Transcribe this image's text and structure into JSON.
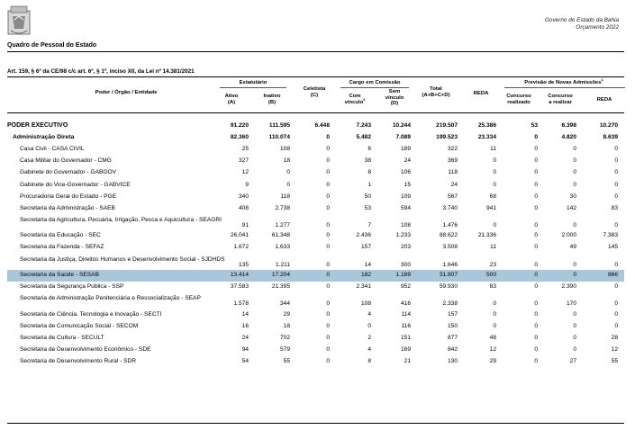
{
  "header": {
    "government": "Governo do Estado da Bahia",
    "budget": "Orçamento 2022"
  },
  "title": "Quadro de Pessoal do Estado",
  "article": "Art. 159, § 6º da CE/98 c/c art. 6º, § 1º, inciso XII, da Lei nº 14.381/2021",
  "headers": {
    "entity": "Poder / Órgão / Entidade",
    "statutory_group": "Estatutário",
    "active": "Ativo",
    "active_code": "(A)",
    "inactive": "Inativo",
    "inactive_code": "(B)",
    "celetista": "Celetista",
    "celetista_code": "(C)",
    "commission_group": "Cargo em Comissão",
    "with_link": "Com",
    "with_link_2": "vínculo",
    "with_link_sup": "2",
    "without_link": "Sem",
    "without_link_2": "vínculo",
    "without_link_code": "(D)",
    "total": "Total",
    "total_code": "(A+B+C+D)",
    "reda": "REDA",
    "admissions_group": "Previsão de Novas Admissões",
    "admissions_sup": "1",
    "contest_done": "Concurso",
    "contest_done_2": "realizado",
    "contest_todo": "Concurso",
    "contest_todo_2": "a realizar",
    "reda_new": "REDA"
  },
  "highlight_color": "#a9c6da",
  "rows": [
    {
      "name": "PODER EXECUTIVO",
      "level": 0,
      "values": [
        "91.220",
        "111.595",
        "6.448",
        "7.243",
        "10.244",
        "219.507",
        "25.386",
        "53",
        "6.398",
        "10.270"
      ]
    },
    {
      "name": "Administração Direta",
      "level": 1,
      "values": [
        "82.360",
        "110.074",
        "0",
        "5.482",
        "7.089",
        "199.523",
        "23.334",
        "0",
        "4.820",
        "8.639"
      ]
    },
    {
      "name": "Casa Civil - CASA CIVIL",
      "level": 2,
      "values": [
        "25",
        "108",
        "0",
        "6",
        "189",
        "322",
        "11",
        "0",
        "0",
        "0"
      ]
    },
    {
      "name": "Casa Militar do Governador - CMG",
      "level": 2,
      "values": [
        "327",
        "18",
        "0",
        "38",
        "24",
        "369",
        "0",
        "0",
        "0",
        "0"
      ]
    },
    {
      "name": "Gabinete do Governador - GABGOV",
      "level": 2,
      "values": [
        "12",
        "0",
        "0",
        "8",
        "106",
        "118",
        "0",
        "0",
        "0",
        "0"
      ]
    },
    {
      "name": "Gabinete do Vice-Governador - GABVICE",
      "level": 2,
      "values": [
        "9",
        "0",
        "0",
        "1",
        "15",
        "24",
        "0",
        "0",
        "0",
        "0"
      ]
    },
    {
      "name": "Procuradoria Geral do Estado - PGE",
      "level": 2,
      "values": [
        "340",
        "118",
        "0",
        "50",
        "109",
        "567",
        "68",
        "0",
        "30",
        "0"
      ]
    },
    {
      "name": "Secretaria da Administração - SAEB",
      "level": 2,
      "values": [
        "408",
        "2.738",
        "0",
        "53",
        "594",
        "3.740",
        "941",
        "0",
        "142",
        "83"
      ]
    },
    {
      "name": "Secretaria da Agricultura, Pecuária, Irrigação, Pesca e Aquicultura - SEAGRI",
      "level": 2,
      "lines": 2,
      "values": [
        "91",
        "1.277",
        "0",
        "7",
        "108",
        "1.476",
        "0",
        "0",
        "0",
        "0"
      ]
    },
    {
      "name": "Secretaria da Educação - SEC",
      "level": 2,
      "values": [
        "26.041",
        "61.348",
        "0",
        "2.436",
        "1.233",
        "88.622",
        "21.336",
        "0",
        "2.000",
        "7.383"
      ]
    },
    {
      "name": "Secretaria da Fazenda - SEFAZ",
      "level": 2,
      "values": [
        "1.672",
        "1.633",
        "0",
        "157",
        "203",
        "3.508",
        "11",
        "0",
        "49",
        "145"
      ]
    },
    {
      "name": "Secretaria da Justiça, Direitos Humanos e Desenvolvimento Social - SJDHDS",
      "level": 2,
      "lines": 2,
      "values": [
        "135",
        "1.211",
        "0",
        "14",
        "300",
        "1.646",
        "23",
        "0",
        "0",
        "0"
      ]
    },
    {
      "name": "Secretaria da Saúde - SESAB",
      "level": 2,
      "highlight": true,
      "values": [
        "13.414",
        "17.204",
        "0",
        "182",
        "1.189",
        "31.807",
        "500",
        "0",
        "0",
        "866"
      ]
    },
    {
      "name": "Secretaria da Segurança Pública - SSP",
      "level": 2,
      "values": [
        "37.583",
        "21.395",
        "0",
        "2.341",
        "952",
        "59.930",
        "83",
        "0",
        "2.390",
        "0"
      ]
    },
    {
      "name": "Secretaria de Administração Penitenciária e Ressocialização - SEAP",
      "level": 2,
      "lines": 2,
      "values": [
        "1.578",
        "344",
        "0",
        "108",
        "416",
        "2.338",
        "0",
        "0",
        "170",
        "0"
      ]
    },
    {
      "name": "Secretaria de Ciência, Tecnologia e Inovação - SECTI",
      "level": 2,
      "values": [
        "14",
        "29",
        "0",
        "4",
        "114",
        "157",
        "0",
        "0",
        "0",
        "0"
      ]
    },
    {
      "name": "Secretaria de Comunicação Social - SECOM",
      "level": 2,
      "values": [
        "16",
        "18",
        "0",
        "0",
        "116",
        "150",
        "0",
        "0",
        "0",
        "0"
      ]
    },
    {
      "name": "Secretaria de Cultura - SECULT",
      "level": 2,
      "values": [
        "24",
        "702",
        "0",
        "2",
        "151",
        "877",
        "48",
        "0",
        "0",
        "28"
      ]
    },
    {
      "name": "Secretaria de Desenvolvimento Econômico - SDE",
      "level": 2,
      "values": [
        "94",
        "579",
        "0",
        "4",
        "169",
        "842",
        "12",
        "0",
        "0",
        "12"
      ]
    },
    {
      "name": "Secretaria de Desenvolvimento Rural - SDR",
      "level": 2,
      "values": [
        "54",
        "55",
        "0",
        "8",
        "21",
        "130",
        "29",
        "0",
        "27",
        "55"
      ]
    }
  ]
}
